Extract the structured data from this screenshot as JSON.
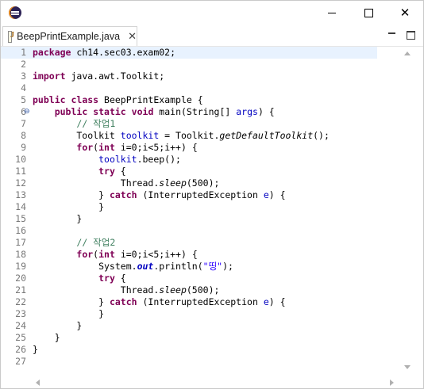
{
  "window": {
    "app_icon": "eclipse-logo",
    "minimize_icon": "minimize-icon",
    "maximize_icon": "maximize-icon",
    "close_glyph": "✕"
  },
  "tab": {
    "label": "BeepPrintExample.java",
    "close_glyph": "✕",
    "icon": "java-file-icon"
  },
  "view_controls": {
    "minimize_icon": "view-minimize-icon",
    "maximize_icon": "view-maximize-icon"
  },
  "editor": {
    "current_line": 1,
    "folded_marker": "⊖",
    "colors": {
      "keyword": "#7f0055",
      "comment": "#3f7f5f",
      "field": "#0000c0",
      "string": "#2a00ff",
      "current_line_bg": "#e8f2fe"
    },
    "lines": [
      {
        "num": "1",
        "tokens": [
          {
            "t": "package",
            "c": "kw"
          },
          {
            "t": " ch14.sec03.exam02;"
          }
        ]
      },
      {
        "num": "2",
        "tokens": []
      },
      {
        "num": "3",
        "tokens": [
          {
            "t": "import",
            "c": "kw"
          },
          {
            "t": " java.awt.Toolkit;"
          }
        ]
      },
      {
        "num": "4",
        "tokens": []
      },
      {
        "num": "5",
        "tokens": [
          {
            "t": "public",
            "c": "kw"
          },
          {
            "t": " "
          },
          {
            "t": "class",
            "c": "kw"
          },
          {
            "t": " BeepPrintExample {"
          }
        ]
      },
      {
        "num": "6",
        "fold": true,
        "tokens": [
          {
            "t": "    "
          },
          {
            "t": "public",
            "c": "kw"
          },
          {
            "t": " "
          },
          {
            "t": "static",
            "c": "kw"
          },
          {
            "t": " "
          },
          {
            "t": "void",
            "c": "kw"
          },
          {
            "t": " main(String[] "
          },
          {
            "t": "args",
            "c": "fld"
          },
          {
            "t": ") {"
          }
        ]
      },
      {
        "num": "7",
        "tokens": [
          {
            "t": "        "
          },
          {
            "t": "// 작업1",
            "c": "cm"
          }
        ]
      },
      {
        "num": "8",
        "tokens": [
          {
            "t": "        Toolkit "
          },
          {
            "t": "toolkit",
            "c": "fld"
          },
          {
            "t": " = Toolkit."
          },
          {
            "t": "getDefaultToolkit",
            "c": "ital"
          },
          {
            "t": "();"
          }
        ]
      },
      {
        "num": "9",
        "tokens": [
          {
            "t": "        "
          },
          {
            "t": "for",
            "c": "kw"
          },
          {
            "t": "("
          },
          {
            "t": "int",
            "c": "kw"
          },
          {
            "t": " i=0;i<5;i++) {"
          }
        ]
      },
      {
        "num": "10",
        "tokens": [
          {
            "t": "            "
          },
          {
            "t": "toolkit",
            "c": "fld"
          },
          {
            "t": ".beep();"
          }
        ]
      },
      {
        "num": "11",
        "tokens": [
          {
            "t": "            "
          },
          {
            "t": "try",
            "c": "kw"
          },
          {
            "t": " {"
          }
        ]
      },
      {
        "num": "12",
        "tokens": [
          {
            "t": "                Thread."
          },
          {
            "t": "sleep",
            "c": "ital"
          },
          {
            "t": "(500);"
          }
        ]
      },
      {
        "num": "13",
        "tokens": [
          {
            "t": "            } "
          },
          {
            "t": "catch",
            "c": "kw"
          },
          {
            "t": " (InterruptedException "
          },
          {
            "t": "e",
            "c": "fld"
          },
          {
            "t": ") {"
          }
        ]
      },
      {
        "num": "14",
        "tokens": [
          {
            "t": "            }"
          }
        ]
      },
      {
        "num": "15",
        "tokens": [
          {
            "t": "        }"
          }
        ]
      },
      {
        "num": "16",
        "tokens": []
      },
      {
        "num": "17",
        "tokens": [
          {
            "t": "        "
          },
          {
            "t": "// 작업2",
            "c": "cm"
          }
        ]
      },
      {
        "num": "18",
        "tokens": [
          {
            "t": "        "
          },
          {
            "t": "for",
            "c": "kw"
          },
          {
            "t": "("
          },
          {
            "t": "int",
            "c": "kw"
          },
          {
            "t": " i=0;i<5;i++) {"
          }
        ]
      },
      {
        "num": "19",
        "tokens": [
          {
            "t": "            System."
          },
          {
            "t": "out",
            "c": "fi"
          },
          {
            "t": ".println("
          },
          {
            "t": "\"띵\"",
            "c": "str"
          },
          {
            "t": ");"
          }
        ]
      },
      {
        "num": "20",
        "tokens": [
          {
            "t": "            "
          },
          {
            "t": "try",
            "c": "kw"
          },
          {
            "t": " {"
          }
        ]
      },
      {
        "num": "21",
        "tokens": [
          {
            "t": "                Thread."
          },
          {
            "t": "sleep",
            "c": "ital"
          },
          {
            "t": "(500);"
          }
        ]
      },
      {
        "num": "22",
        "tokens": [
          {
            "t": "            } "
          },
          {
            "t": "catch",
            "c": "kw"
          },
          {
            "t": " (InterruptedException "
          },
          {
            "t": "e",
            "c": "fld"
          },
          {
            "t": ") {"
          }
        ]
      },
      {
        "num": "23",
        "tokens": [
          {
            "t": "            }"
          }
        ]
      },
      {
        "num": "24",
        "tokens": [
          {
            "t": "        }"
          }
        ]
      },
      {
        "num": "25",
        "tokens": [
          {
            "t": "    }"
          }
        ]
      },
      {
        "num": "26",
        "tokens": [
          {
            "t": "}"
          }
        ]
      },
      {
        "num": "27",
        "tokens": []
      }
    ]
  }
}
